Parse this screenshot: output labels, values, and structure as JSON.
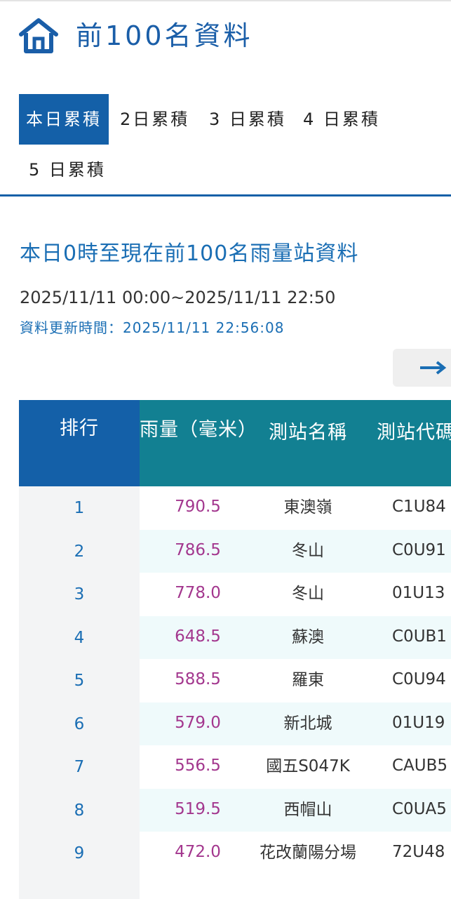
{
  "header": {
    "title": "前100名資料",
    "icon": "home-icon"
  },
  "tabs": [
    {
      "label": "本日累積",
      "active": true
    },
    {
      "label": "2日累積",
      "active": false
    },
    {
      "label": "3 日累積",
      "active": false
    },
    {
      "label": "4 日累積",
      "active": false
    },
    {
      "label": "5 日累積",
      "active": false
    }
  ],
  "section": {
    "title": "本日0時至現在前100名雨量站資料",
    "range": "2025/11/11 00:00~2025/11/11 22:50",
    "update": "資料更新時間：2025/11/11 22:56:08"
  },
  "scroll_button": {
    "icon": "arrow-right-icon"
  },
  "table": {
    "headers": {
      "rank": "排行",
      "rain": "雨量（毫米）",
      "name": "測站名稱",
      "code": "測站代碼"
    },
    "rows": [
      {
        "rank": "1",
        "rain": "790.5",
        "name": "東澳嶺",
        "code": "C1U84"
      },
      {
        "rank": "2",
        "rain": "786.5",
        "name": "冬山",
        "code": "C0U91"
      },
      {
        "rank": "3",
        "rain": "778.0",
        "name": "冬山",
        "code": "01U13"
      },
      {
        "rank": "4",
        "rain": "648.5",
        "name": "蘇澳",
        "code": "C0UB1"
      },
      {
        "rank": "5",
        "rain": "588.5",
        "name": "羅東",
        "code": "C0U94"
      },
      {
        "rank": "6",
        "rain": "579.0",
        "name": "新北城",
        "code": "01U19"
      },
      {
        "rank": "7",
        "rain": "556.5",
        "name": "國五S047K",
        "code": "CAUB5"
      },
      {
        "rank": "8",
        "rain": "519.5",
        "name": "西帽山",
        "code": "C0UA5"
      },
      {
        "rank": "9",
        "rain": "472.0",
        "name": "花改蘭陽分場",
        "code": "72U48"
      }
    ]
  },
  "colors": {
    "primary": "#1460a8",
    "teal": "#128092",
    "rain": "#a3378e"
  }
}
